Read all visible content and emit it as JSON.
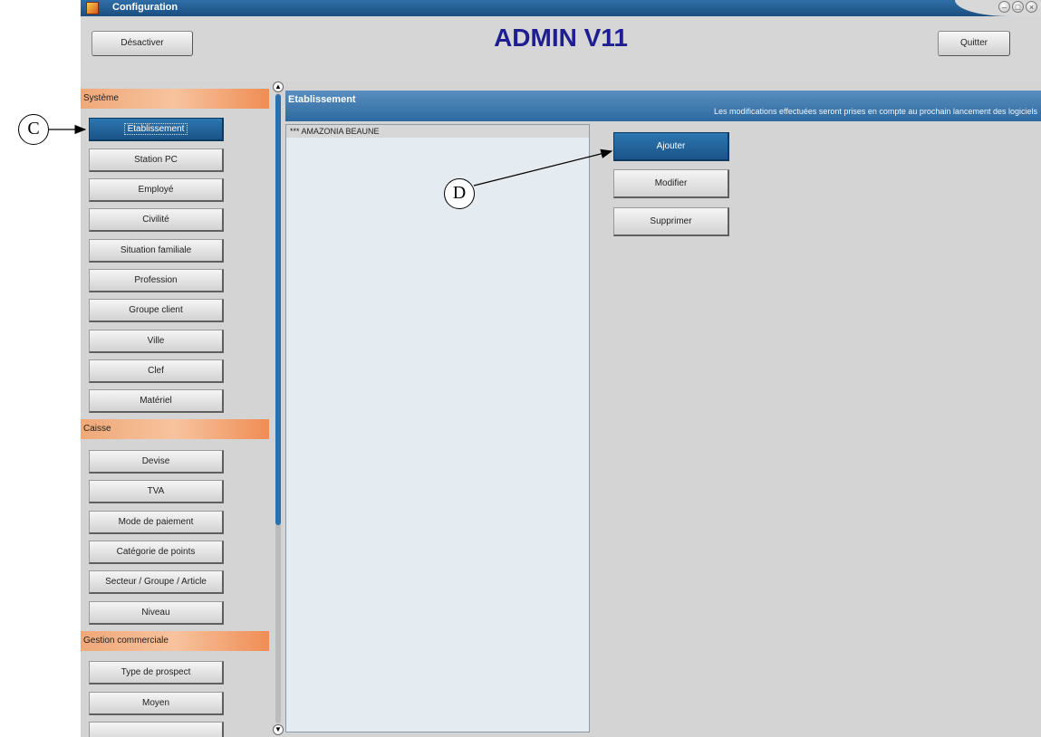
{
  "window": {
    "title": "Configuration",
    "controls": [
      "minimize-icon",
      "maximize-icon",
      "close-icon"
    ]
  },
  "header": {
    "app_title": "ADMIN V11",
    "deactivate_label": "Désactiver",
    "quit_label": "Quitter"
  },
  "sidebar": {
    "sections": [
      {
        "label": "Système",
        "items": [
          "Etablissement",
          "Station PC",
          "Employé",
          "Civilité",
          "Situation familiale",
          "Profession",
          "Groupe client",
          "Ville",
          "Clef",
          "Matériel"
        ]
      },
      {
        "label": "Caisse",
        "items": [
          "Devise",
          "TVA",
          "Mode de paiement",
          "Catégorie de points",
          "Secteur / Groupe / Article",
          "Niveau"
        ]
      },
      {
        "label": "Gestion commerciale",
        "items": [
          "Type de prospect",
          "Moyen"
        ]
      }
    ],
    "active_item": "Etablissement"
  },
  "panel": {
    "title": "Etablissement",
    "note": "Les modifications effectuées seront prises en compte au prochain lancement des logiciels",
    "list_items": [
      "*** AMAZONIA BEAUNE"
    ],
    "buttons": {
      "add": "Ajouter",
      "modify": "Modifier",
      "delete": "Supprimer"
    }
  },
  "annotations": {
    "c": "C",
    "d": "D"
  },
  "colors": {
    "accent_blue": "#2c6aa0",
    "section_orange": "#f0a878",
    "title_navy": "#1e1e90"
  }
}
